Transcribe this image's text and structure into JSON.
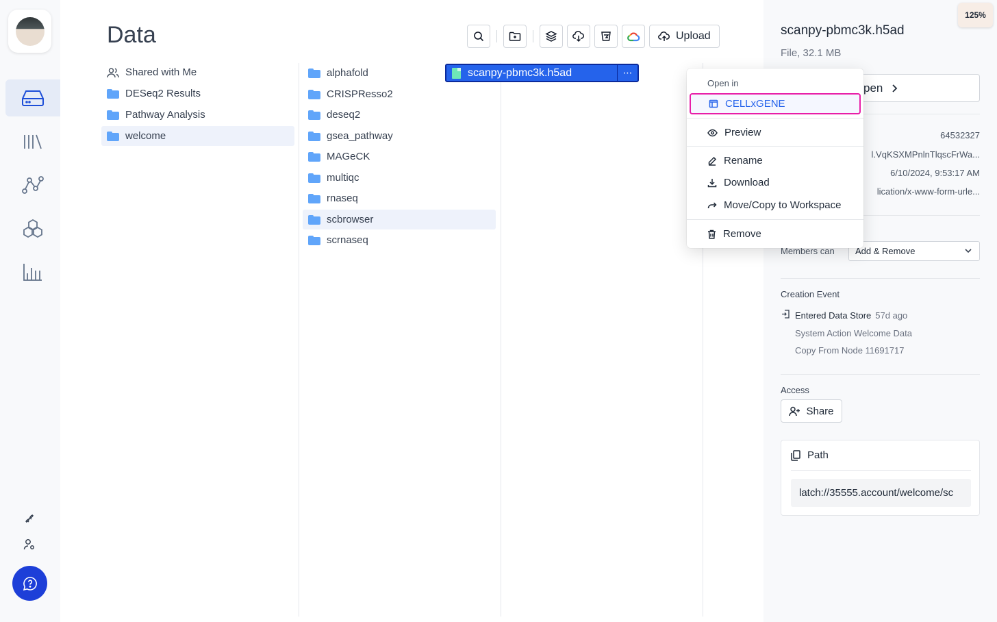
{
  "rail": {
    "items": [
      {
        "name": "data-storage",
        "icon": "hard-drive-icon",
        "active": true
      },
      {
        "name": "library",
        "icon": "library-icon",
        "active": false
      },
      {
        "name": "workflows",
        "icon": "graph-nodes-icon",
        "active": false
      },
      {
        "name": "registry",
        "icon": "hexagon-cluster-icon",
        "active": false
      },
      {
        "name": "analytics",
        "icon": "bar-chart-icon",
        "active": false
      }
    ]
  },
  "main": {
    "title": "Data",
    "toolbar": {
      "upload_label": "Upload"
    },
    "column1": [
      {
        "label": "Shared with Me",
        "icon": "users-icon",
        "selected": false
      },
      {
        "label": "DESeq2 Results",
        "icon": "folder-icon",
        "selected": false
      },
      {
        "label": "Pathway Analysis",
        "icon": "folder-icon",
        "selected": false
      },
      {
        "label": "welcome",
        "icon": "folder-icon",
        "selected": true
      }
    ],
    "column2": [
      {
        "label": "alphafold",
        "selected": false
      },
      {
        "label": "CRISPResso2",
        "selected": false
      },
      {
        "label": "deseq2",
        "selected": false
      },
      {
        "label": "gsea_pathway",
        "selected": false
      },
      {
        "label": "MAGeCK",
        "selected": false
      },
      {
        "label": "multiqc",
        "selected": false
      },
      {
        "label": "rnaseq",
        "selected": false
      },
      {
        "label": "scbrowser",
        "selected": true
      },
      {
        "label": "scrnaseq",
        "selected": false
      }
    ],
    "column3": {
      "selected_file": "scanpy-pbmc3k.h5ad"
    }
  },
  "context_menu": {
    "header": "Open in",
    "items": {
      "cellxgene": "CELLxGENE",
      "preview": "Preview",
      "rename": "Rename",
      "download": "Download",
      "move_copy": "Move/Copy to Workspace",
      "remove": "Remove"
    }
  },
  "zoom": "125%",
  "details": {
    "title": "scanpy-pbmc3k.h5ad",
    "subtitle": "File, 32.1 MB",
    "open_label": "pen",
    "meta_values": [
      "64532327",
      "l.VqKSXMPnlnTlqscFrWa...",
      "6/10/2024, 9:53:17 AM",
      "lication/x-www-form-urle..."
    ],
    "members_label": "Members can",
    "members_value": "Add & Remove",
    "creation_label": "Creation Event",
    "event_title": "Entered Data Store",
    "event_time": "57d ago",
    "event_line1": "System Action Welcome Data",
    "event_line2": "Copy From Node 11691717",
    "access_label": "Access",
    "share_label": "Share",
    "path_label": "Path",
    "path_value": "latch://35555.account/welcome/sc"
  }
}
